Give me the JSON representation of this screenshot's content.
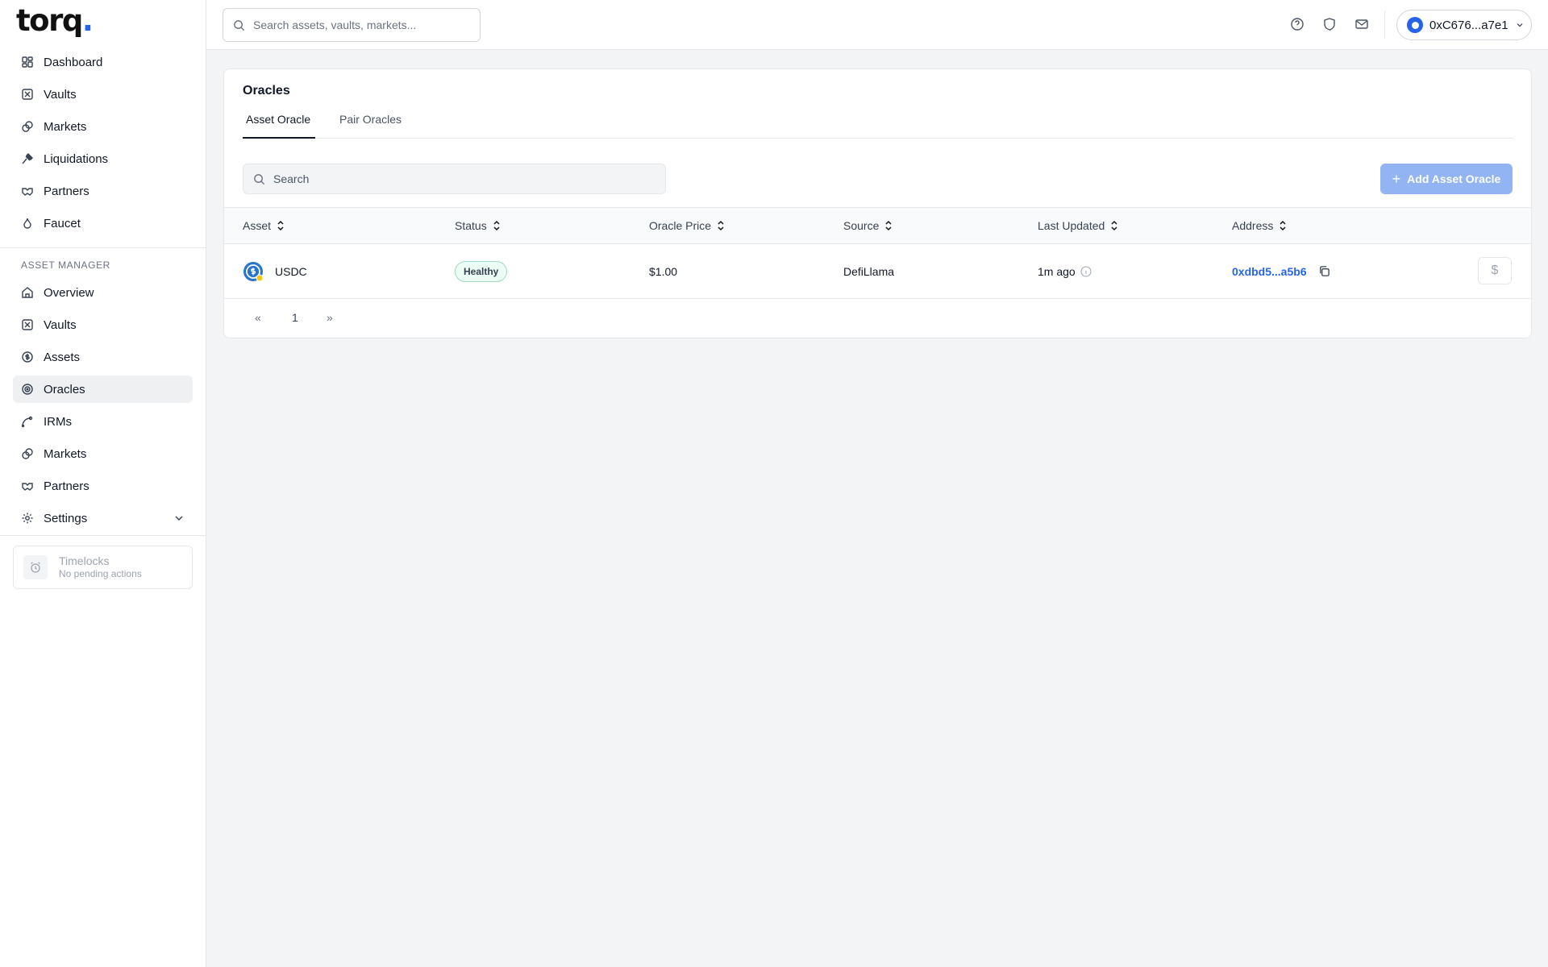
{
  "app": {
    "logo_text": "torq",
    "logo_dot": "."
  },
  "sidebar": {
    "top_items": [
      {
        "label": "Dashboard",
        "icon": "dashboard-icon"
      },
      {
        "label": "Vaults",
        "icon": "vault-icon"
      },
      {
        "label": "Markets",
        "icon": "markets-icon"
      },
      {
        "label": "Liquidations",
        "icon": "gavel-icon"
      },
      {
        "label": "Partners",
        "icon": "handshake-icon"
      },
      {
        "label": "Faucet",
        "icon": "faucet-icon"
      }
    ],
    "section_label": "ASSET MANAGER",
    "am_items": [
      {
        "label": "Overview",
        "icon": "home-icon"
      },
      {
        "label": "Vaults",
        "icon": "vault-icon"
      },
      {
        "label": "Assets",
        "icon": "dollar-circle-icon"
      },
      {
        "label": "Oracles",
        "icon": "oracle-icon",
        "active": true
      },
      {
        "label": "IRMs",
        "icon": "curve-icon"
      },
      {
        "label": "Markets",
        "icon": "markets-icon"
      },
      {
        "label": "Partners",
        "icon": "handshake-icon"
      },
      {
        "label": "Settings",
        "icon": "gear-icon"
      }
    ],
    "timelocks": {
      "title": "Timelocks",
      "subtitle": "No pending actions",
      "icon": "alarm-clock-icon"
    }
  },
  "header": {
    "search_placeholder": "Search assets, vaults, markets...",
    "icons": [
      "help-icon",
      "shield-icon",
      "mail-icon"
    ],
    "wallet_address": "0xC676...a7e1"
  },
  "page": {
    "title": "Oracles",
    "tabs": [
      {
        "label": "Asset Oracle",
        "active": true
      },
      {
        "label": "Pair Oracles",
        "active": false
      }
    ],
    "search_placeholder": "Search",
    "add_button_label": "Add Asset Oracle",
    "table": {
      "columns": [
        "Asset",
        "Status",
        "Oracle Price",
        "Source",
        "Last Updated",
        "Address"
      ],
      "rows": [
        {
          "asset": "USDC",
          "status": "Healthy",
          "price": "$1.00",
          "source": "DefiLlama",
          "updated": "1m ago",
          "address": "0xdbd5...a5b6",
          "action_icon": "dollar-icon",
          "action_symbol": "$"
        }
      ]
    },
    "pagination": {
      "prev": "«",
      "current": "1",
      "next": "»"
    }
  },
  "colors": {
    "accent": "#2563eb",
    "add_button": "#93b4f3",
    "healthy_bg": "#ecfdf5",
    "healthy_border": "#a7d7c5"
  }
}
